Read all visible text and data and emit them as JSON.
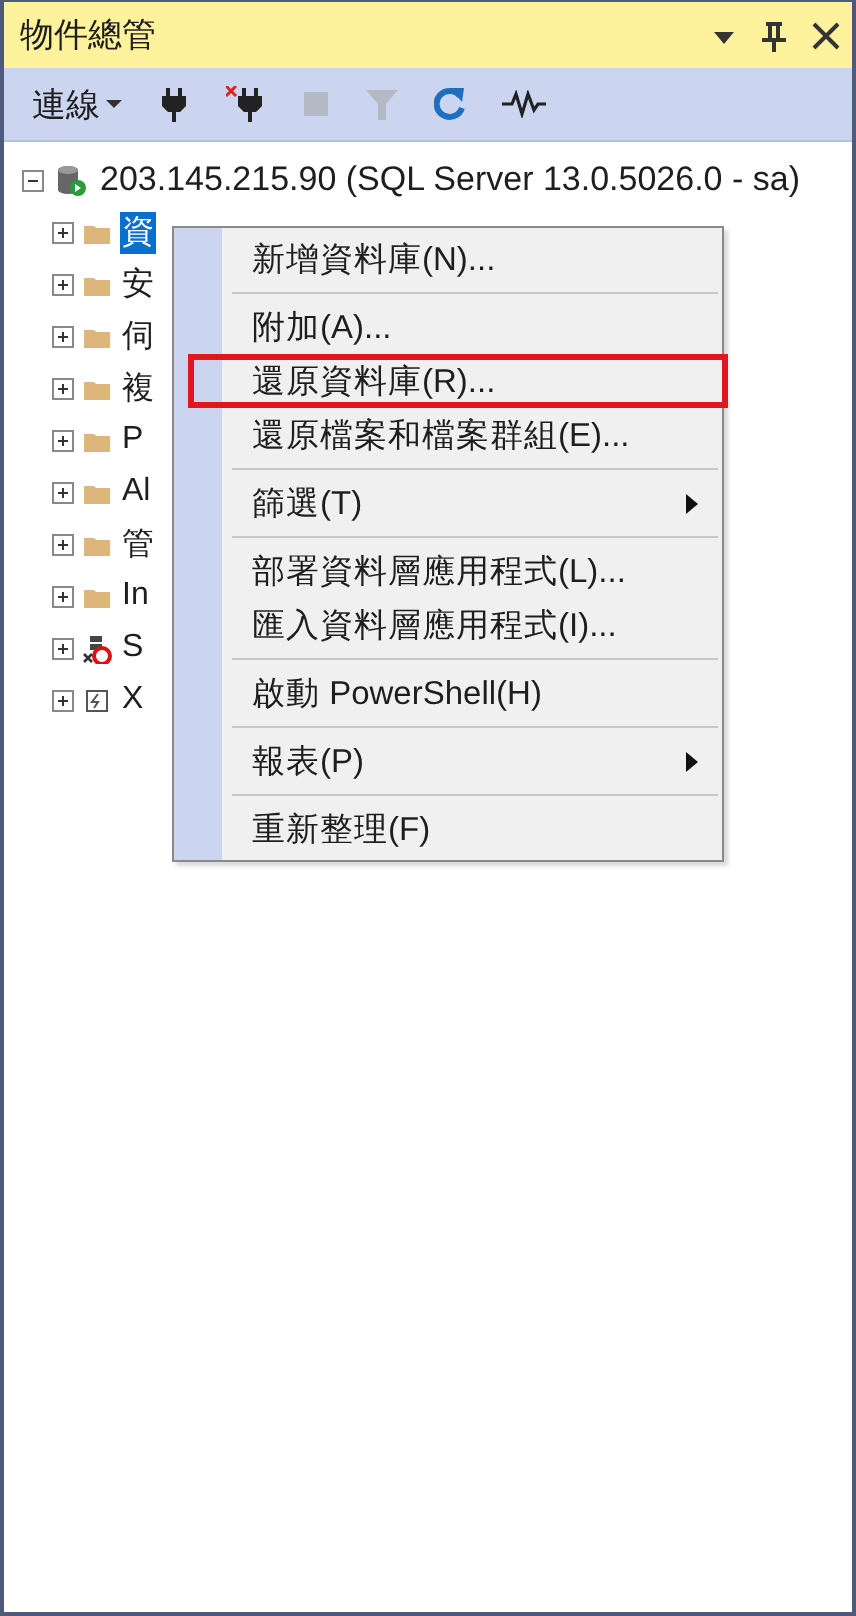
{
  "panel": {
    "title": "物件總管"
  },
  "toolbar": {
    "connect_label": "連線",
    "tools": [
      {
        "kind": "connect",
        "disabled": false
      },
      {
        "kind": "disconnect",
        "disabled": false
      },
      {
        "kind": "stop",
        "disabled": true
      },
      {
        "kind": "filter",
        "disabled": true
      },
      {
        "kind": "refresh",
        "disabled": false
      },
      {
        "kind": "activity",
        "disabled": false
      }
    ]
  },
  "tree": {
    "label": "203.145.215.90 (SQL Server 13.0.5026.0 - sa)",
    "expanded": true,
    "children": [
      {
        "label": "資",
        "kind": "folder",
        "selected": true,
        "expanded": false
      },
      {
        "label": "安",
        "kind": "folder",
        "selected": false,
        "expanded": false
      },
      {
        "label": "伺",
        "kind": "folder",
        "selected": false,
        "expanded": false
      },
      {
        "label": "複",
        "kind": "folder",
        "selected": false,
        "expanded": false
      },
      {
        "label": "P",
        "kind": "folder",
        "selected": false,
        "expanded": false
      },
      {
        "label": "Al",
        "kind": "folder",
        "selected": false,
        "expanded": false
      },
      {
        "label": "管",
        "kind": "folder",
        "selected": false,
        "expanded": false
      },
      {
        "label": "In",
        "kind": "folder",
        "selected": false,
        "expanded": false
      },
      {
        "label": "S",
        "kind": "agent",
        "selected": false,
        "expanded": false
      },
      {
        "label": "X",
        "kind": "xevent",
        "selected": false,
        "expanded": false
      }
    ]
  },
  "context_menu": {
    "items": [
      {
        "label": "新增資料庫(N)...",
        "submenu": false,
        "highlighted": false,
        "separator_after": true
      },
      {
        "label": "附加(A)...",
        "submenu": false,
        "highlighted": false,
        "separator_after": false
      },
      {
        "label": "還原資料庫(R)...",
        "submenu": false,
        "highlighted": true,
        "separator_after": false
      },
      {
        "label": "還原檔案和檔案群組(E)...",
        "submenu": false,
        "highlighted": false,
        "separator_after": true
      },
      {
        "label": "篩選(T)",
        "submenu": true,
        "highlighted": false,
        "separator_after": true
      },
      {
        "label": "部署資料層應用程式(L)...",
        "submenu": false,
        "highlighted": false,
        "separator_after": false
      },
      {
        "label": "匯入資料層應用程式(I)...",
        "submenu": false,
        "highlighted": false,
        "separator_after": true
      },
      {
        "label": "啟動 PowerShell(H)",
        "submenu": false,
        "highlighted": false,
        "separator_after": true
      },
      {
        "label": "報表(P)",
        "submenu": true,
        "highlighted": false,
        "separator_after": true
      },
      {
        "label": "重新整理(F)",
        "submenu": false,
        "highlighted": false,
        "separator_after": false
      }
    ]
  }
}
